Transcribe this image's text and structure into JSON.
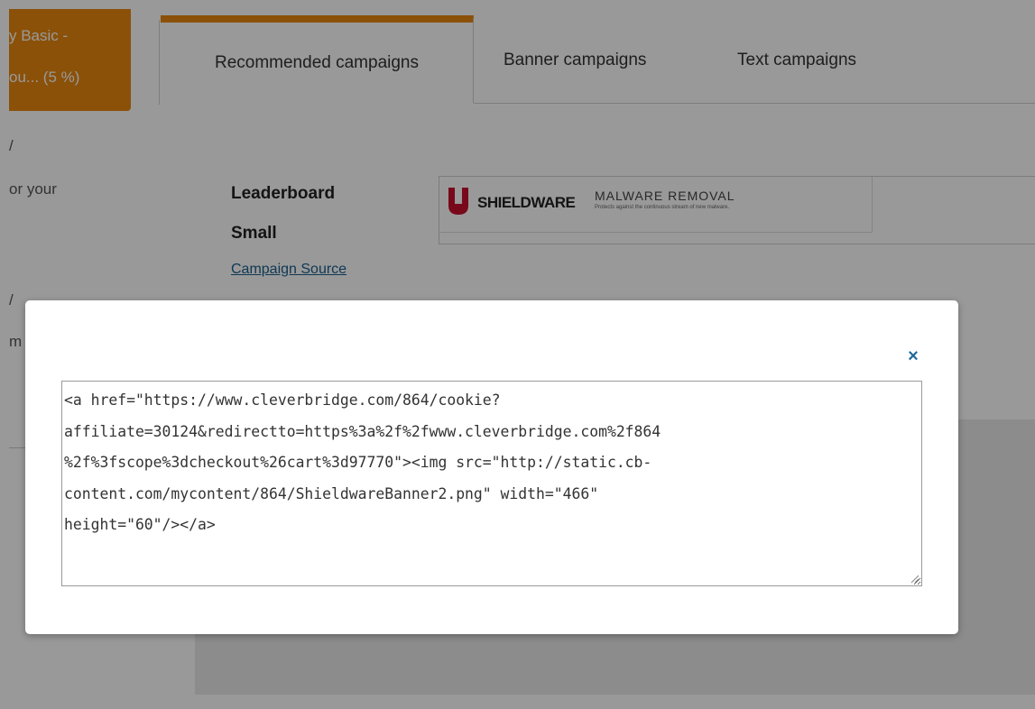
{
  "product_tile": {
    "line1": "y Basic -",
    "line2": "ou... (5 %)"
  },
  "tabs": [
    {
      "label": "Recommended campaigns",
      "active": true
    },
    {
      "label": "Banner campaigns",
      "active": false
    },
    {
      "label": "Text campaigns",
      "active": false
    }
  ],
  "left_fragments": {
    "a": "/",
    "b": "or your",
    "c": "/",
    "d": "m"
  },
  "campaign": {
    "format_label": "Leaderboard",
    "size_label": "Small",
    "source_link": "Campaign Source",
    "banner": {
      "brand": "SHIELDWARE",
      "title": "MALWARE REMOVAL",
      "subtitle": "Protects against the continuous stream of new malware."
    }
  },
  "modal": {
    "close_label": "×",
    "code_lines": [
      "<a href=\"https://www.cleverbridge.com/864/cookie?",
      "affiliate=30124&redirectto=https%3a%2f%2fwww.cleverbridge.com%2f864",
      "%2f%3fscope%3dcheckout%26cart%3d97770\"><img src=\"http://static.cb-",
      "content.com/mycontent/864/ShieldwareBanner2.png\" width=\"466\"",
      "height=\"60\"/></a>"
    ]
  },
  "colors": {
    "accent": "#e8870f",
    "link": "#1a5f8a",
    "close": "#1e6a9a",
    "brand_red": "#c8102e"
  }
}
